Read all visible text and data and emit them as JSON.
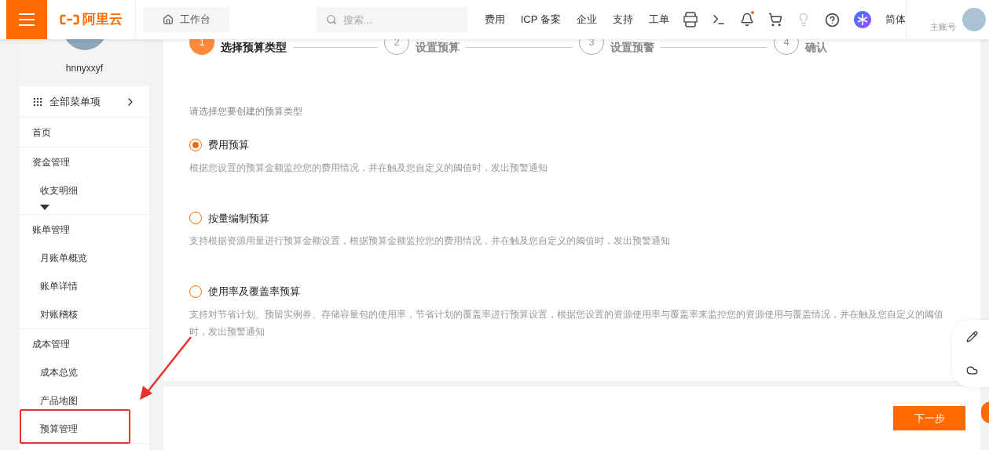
{
  "header": {
    "brand": "阿里云",
    "workbench": "工作台",
    "search": {
      "placeholder": "搜索..."
    },
    "nav": [
      "费用",
      "ICP 备案",
      "企业",
      "支持",
      "工单"
    ],
    "notifications_unread": true,
    "language": "简体",
    "account_type": "主账号"
  },
  "sidebar": {
    "username": "hnnyxxyf",
    "all_menu": "全部菜单项",
    "menu": [
      {
        "label": "首页",
        "collapsible": false
      },
      {
        "label": "资金管理",
        "children": [
          "收支明细"
        ],
        "collapsible": true
      },
      {
        "label": "账单管理",
        "collapsible": false,
        "children": [
          "月账单概览",
          "账单详情",
          "对账稽核"
        ]
      },
      {
        "label": "成本管理",
        "collapsible": false,
        "children": [
          "成本总览",
          "产品地图",
          "预算管理"
        ]
      }
    ]
  },
  "steps": [
    {
      "number": "1",
      "label": "选择预算类型",
      "active": true
    },
    {
      "number": "2",
      "label": "设置预算",
      "active": false
    },
    {
      "number": "3",
      "label": "设置预警",
      "active": false
    },
    {
      "number": "4",
      "label": "确认",
      "active": false
    }
  ],
  "prompt": "请选择您要创建的预算类型",
  "options": [
    {
      "label": "费用预算",
      "description": "根据您设置的预算金额监控您的费用情况，并在触及您自定义的阈值时，发出预警通知",
      "selected": true
    },
    {
      "label": "按量编制预算",
      "description": "支持根据资源用量进行预算金额设置，根据预算金额监控您的费用情况，并在触及您自定义的阈值时，发出预警通知",
      "selected": false
    },
    {
      "label": "使用率及覆盖率预算",
      "description": "支持对节省计划、预留实例券、存储容量包的使用率，节省计划的覆盖率进行预算设置，根据您设置的资源使用率与覆盖率来监控您的资源使用与覆盖情况，并在触及您自定义的阈值时，发出预警通知",
      "selected": false
    }
  ],
  "next_button": "下一步"
}
